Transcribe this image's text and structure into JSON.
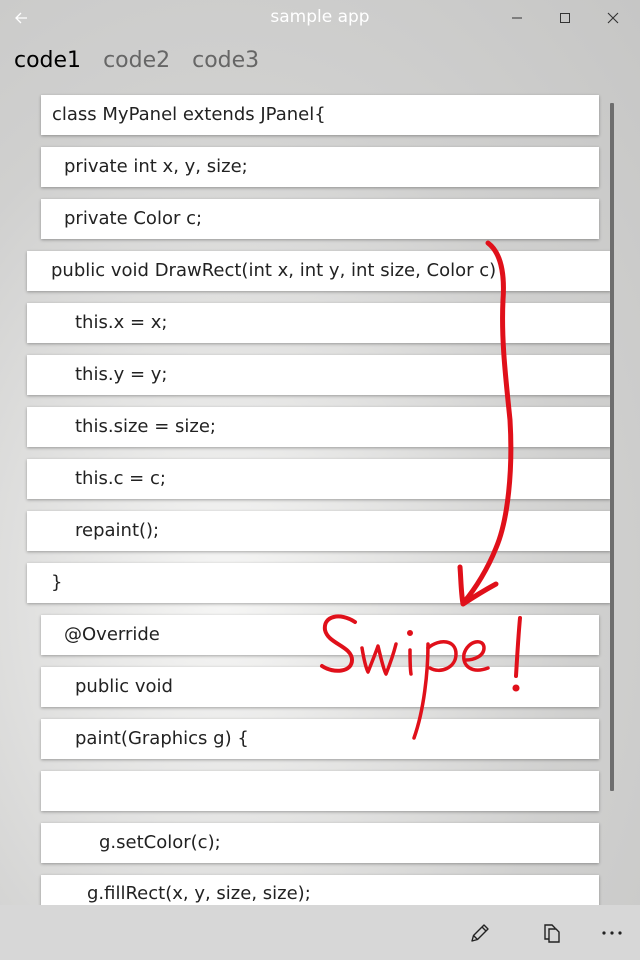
{
  "app": {
    "title": "sample app"
  },
  "tabs": [
    {
      "label": "code1",
      "active": true
    },
    {
      "label": "code2",
      "active": false
    },
    {
      "label": "code3",
      "active": false
    }
  ],
  "code_lines": [
    "class MyPanel extends JPanel{",
    "private int x, y, size;",
    "private Color c;",
    "public void DrawRect(int x, int y, int size, Color c)",
    "this.x = x;",
    "this.y = y;",
    "this.size = size;",
    "this.c = c;",
    "repaint();",
    "}",
    "@Override",
    "public void",
    "paint(Graphics g) {",
    "",
    "g.setColor(c);",
    "g.fillRect(x, y, size, size);"
  ],
  "annotation": {
    "text": "Swipe!",
    "color": "#e0101a"
  },
  "icons": {
    "back": "back-arrow-icon",
    "minimize": "minimize-icon",
    "maximize": "maximize-icon",
    "close": "close-icon",
    "edit": "pencil-icon",
    "copy": "copy-icon",
    "more": "more-icon"
  }
}
